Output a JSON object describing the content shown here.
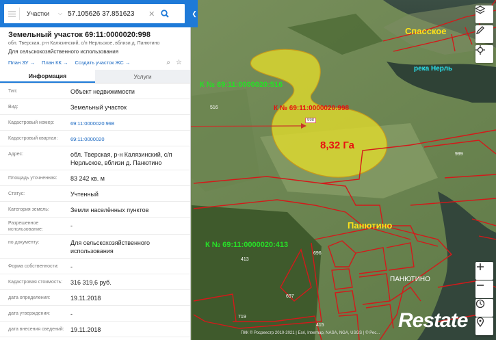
{
  "search": {
    "category": "Участки",
    "query": "57.105626 37.851623"
  },
  "parcel": {
    "title": "Земельный участок 69:11:0000020:998",
    "address_short": "обл. Тверская, р-н Калязинский, с/п Нерльское, вблизи д. Панютино",
    "purpose": "Для сельскохозяйственного использования",
    "links": [
      "План ЗУ",
      "План КК",
      "Создать участок ЖС"
    ]
  },
  "tabs": [
    "Информация",
    "Услуги"
  ],
  "info_rows": [
    {
      "key": "Тип:",
      "value": "Объект недвижимости"
    },
    {
      "key": "Вид:",
      "value": "Земельный участок"
    },
    {
      "key": "Кадастровый номер:",
      "value": "69:11:0000020:998"
    },
    {
      "key": "Кадастровый квартал:",
      "value": "69:11:0000020"
    },
    {
      "key": "Адрес:",
      "value": "обл. Тверская, р-н Калязинский, с/п Нерльское, вблизи д. Панютино"
    },
    {
      "key": "Площадь уточненная:",
      "value": "83 242 кв. м"
    },
    {
      "key": "Статус:",
      "value": "Учтенный"
    },
    {
      "key": "Категория земель:",
      "value": "Земли населённых пунктов"
    },
    {
      "key": "Разрешенное использование:",
      "value": "-"
    },
    {
      "key": "по документу:",
      "value": "Для сельскохозяйственного использования"
    },
    {
      "key": "Форма собственности:",
      "value": "-"
    },
    {
      "key": "Кадастровая стоимость:",
      "value": "316 319,6 руб."
    },
    {
      "key": "дата определения:",
      "value": "19.11.2018"
    },
    {
      "key": "дата утверждения:",
      "value": "-"
    },
    {
      "key": "дата внесения сведений:",
      "value": "19.11.2018"
    }
  ],
  "map": {
    "labels": {
      "village_spasskoe": "Спасское",
      "river": "река Нерль",
      "parcel_516": "К № 69:11:0000020:516",
      "parcel_998": "К № 69:11:0000020:998",
      "parcel_998_tag": "998",
      "area": "8,32 Га",
      "num_516": "516",
      "num_999": "999",
      "panyutino_red": "Панютино",
      "parcel_413": "К № 69:11:0000020:413",
      "num_413": "413",
      "num_696": "696",
      "num_697": "697",
      "num_719": "719",
      "num_415": "415",
      "panyutino_white": "ПАНЮТИНО",
      "watermark": "Restate",
      "copyright": "ПКК © Росреестр 2010-2021 | Esri, Intermap, NASA, NGA, USGS | © Рес..."
    },
    "colors": {
      "parcel_fill": "#e3dc2b",
      "boundary": "#d4191a",
      "accent": "#1e7ad8"
    }
  }
}
